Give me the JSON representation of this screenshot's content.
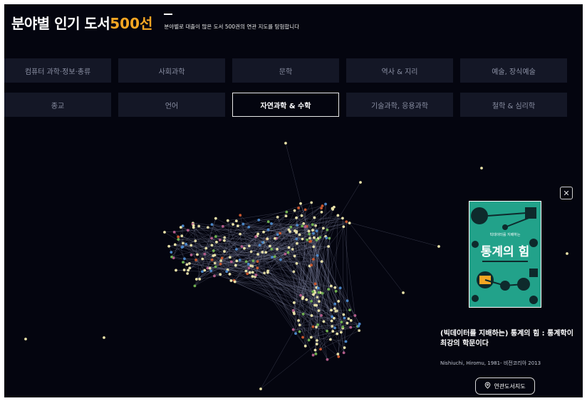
{
  "header": {
    "title_main": "분야별 인기 도서",
    "title_accent": "500선",
    "subtitle": "분야별로 대출이 많은 도서 500권의 연관 지도를 탐험합니다"
  },
  "categories": [
    {
      "label": "컴퓨터 과학·정보·총류",
      "active": false
    },
    {
      "label": "사회과학",
      "active": false
    },
    {
      "label": "문학",
      "active": false
    },
    {
      "label": "역사 & 지리",
      "active": false
    },
    {
      "label": "예술, 장식예술",
      "active": false
    },
    {
      "label": "종교",
      "active": false
    },
    {
      "label": "언어",
      "active": false
    },
    {
      "label": "자연과학 & 수학",
      "active": true
    },
    {
      "label": "기술과학, 응용과학",
      "active": false
    },
    {
      "label": "철학 & 심리학",
      "active": false
    }
  ],
  "detail": {
    "close_icon": "close-icon",
    "cover": {
      "small_title": "빅데이터를 지배하는",
      "big_title": "통계의 힘"
    },
    "title": "(빅데이터를 지배하는) 통계의 힘 : 통계학이 최강의 학문이다",
    "meta": "Nishiuchi, Hiromu, 1981- 비전코리아 2013",
    "related_button": "연관도서지도",
    "related_icon": "map-pin-icon"
  },
  "colors": {
    "background": "#04050f",
    "accent": "#f5a623",
    "button_bg": "#141726",
    "node_default": "#e8e1a8",
    "cover_bg": "#22a28a"
  }
}
